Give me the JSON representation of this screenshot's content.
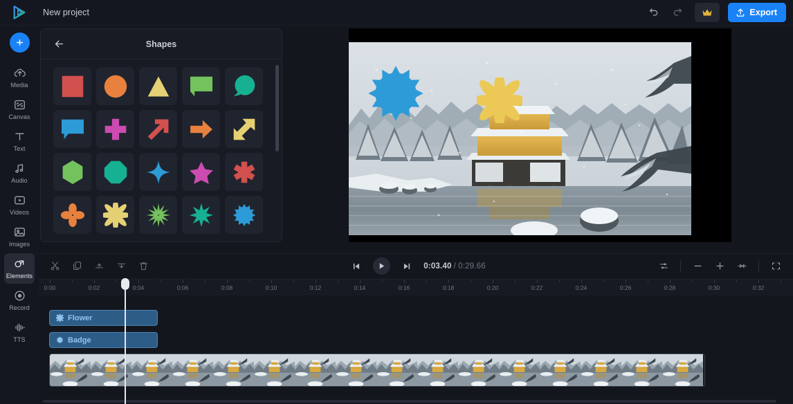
{
  "app": {
    "project_title": "New project",
    "logo_name": "play-logo"
  },
  "topbar": {
    "undo_label": "Undo",
    "redo_label": "Redo",
    "upgrade_label": "Upgrade",
    "export_label": "Export"
  },
  "sidebar": {
    "add_label": "+",
    "items": [
      {
        "label": "Media",
        "icon": "cloud-upload-icon",
        "active": false
      },
      {
        "label": "Canvas",
        "icon": "canvas-icon",
        "active": false
      },
      {
        "label": "Text",
        "icon": "text-icon",
        "active": false
      },
      {
        "label": "Audio",
        "icon": "audio-note-icon",
        "active": false
      },
      {
        "label": "Videos",
        "icon": "video-icon",
        "active": false
      },
      {
        "label": "Images",
        "icon": "image-icon",
        "active": false
      },
      {
        "label": "Elements",
        "icon": "elements-icon",
        "active": true
      },
      {
        "label": "Record",
        "icon": "record-icon",
        "active": false
      },
      {
        "label": "TTS",
        "icon": "tts-waveform-icon",
        "active": false
      }
    ]
  },
  "panel": {
    "title": "Shapes",
    "back_label": "Back",
    "shapes": [
      {
        "name": "square",
        "color": "#d2504e"
      },
      {
        "name": "circle",
        "color": "#e8813e"
      },
      {
        "name": "triangle",
        "color": "#e5d173"
      },
      {
        "name": "speech-tag-right",
        "color": "#74c25e"
      },
      {
        "name": "speech-bubble-round",
        "color": "#16b193"
      },
      {
        "name": "speech-bubble-square",
        "color": "#2d9bd8"
      },
      {
        "name": "cross",
        "color": "#cc4bb0"
      },
      {
        "name": "arrow-diagonal",
        "color": "#d2504e"
      },
      {
        "name": "arrow-right",
        "color": "#e8813e"
      },
      {
        "name": "arrow-double-diagonal",
        "color": "#e5d173"
      },
      {
        "name": "hexagon",
        "color": "#74c25e"
      },
      {
        "name": "octagon",
        "color": "#16b193"
      },
      {
        "name": "star-four-point",
        "color": "#2d9bd8"
      },
      {
        "name": "star-five-point",
        "color": "#cc4bb0"
      },
      {
        "name": "asterisk",
        "color": "#d2504e"
      },
      {
        "name": "flower-four-petal",
        "color": "#e8813e"
      },
      {
        "name": "star-eight-petal",
        "color": "#e5d173"
      },
      {
        "name": "burst-twelve",
        "color": "#74c25e"
      },
      {
        "name": "star-eight-point",
        "color": "#16b193"
      },
      {
        "name": "badge-twelve",
        "color": "#2d9bd8"
      }
    ]
  },
  "preview": {
    "scene_description": "Snow-covered golden pavilion beside a lake",
    "overlays": [
      {
        "name": "badge-twelve",
        "color": "#2d9bd8"
      },
      {
        "name": "flower-eight-petal",
        "color": "#ecc956"
      }
    ]
  },
  "timeline": {
    "tools": [
      {
        "name": "split-icon",
        "label": "Split"
      },
      {
        "name": "duplicate-icon",
        "label": "Duplicate"
      },
      {
        "name": "trim-start-icon",
        "label": "Trim start"
      },
      {
        "name": "trim-end-icon",
        "label": "Trim end"
      },
      {
        "name": "delete-icon",
        "label": "Delete"
      }
    ],
    "transport": {
      "prev_label": "Previous frame",
      "play_label": "Play",
      "next_label": "Next frame",
      "current_time": "0:03.40",
      "separator": "/",
      "total_time": "0:29.66"
    },
    "right_tools": [
      {
        "name": "track-settings-icon",
        "label": "Timeline settings"
      },
      {
        "name": "zoom-out-icon",
        "label": "−"
      },
      {
        "name": "zoom-in-icon",
        "label": "+"
      },
      {
        "name": "fit-timeline-icon",
        "label": "Fit"
      },
      {
        "name": "fullscreen-icon",
        "label": "Fullscreen"
      }
    ],
    "ruler_labels": [
      "0:00",
      "0:02",
      "0:04",
      "0:06",
      "0:08",
      "0:10",
      "0:12",
      "0:14",
      "0:16",
      "0:18",
      "0:20",
      "0:22",
      "0:24",
      "0:26",
      "0:28",
      "0:30",
      "0:32"
    ],
    "playhead_time": "0:03.40",
    "clips": [
      {
        "name": "Flower",
        "icon": "flower-icon",
        "track": 0
      },
      {
        "name": "Badge",
        "icon": "badge-icon",
        "track": 1
      }
    ],
    "video_track_label": "Video clip"
  }
}
